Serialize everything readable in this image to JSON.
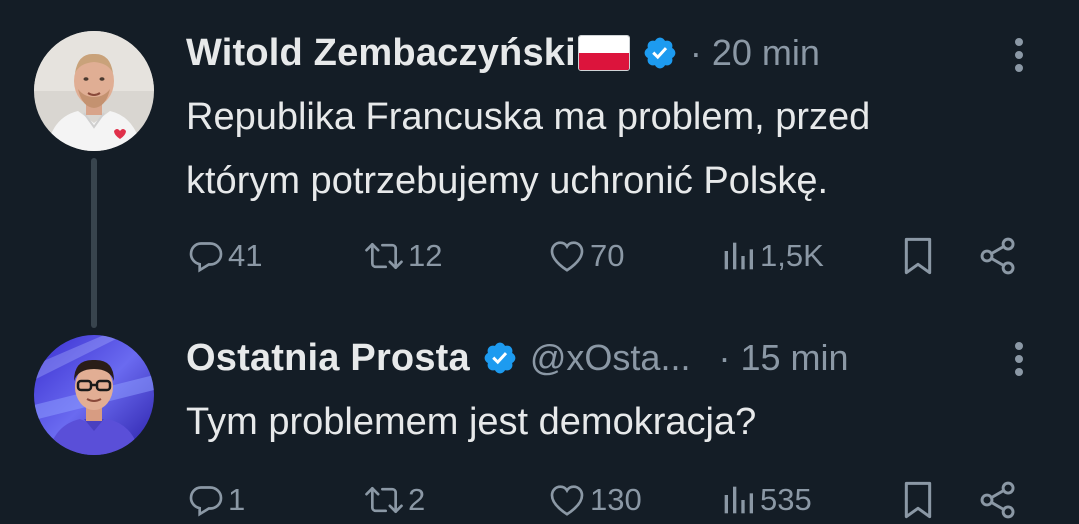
{
  "tweets": [
    {
      "author_name": "Witold Zembaczyński",
      "flag": "poland-flag-emoji",
      "verified": true,
      "time": "· 20 min",
      "text_lines": [
        "Republika Francuska ma problem, przed",
        "którym potrzebujemy uchronić Polskę."
      ],
      "stats": {
        "replies": "41",
        "reposts": "12",
        "likes": "70",
        "views": "1,5K"
      }
    },
    {
      "author_name": "Ostatnia Prosta",
      "verified": true,
      "handle": "@xOsta...",
      "time": "· 15 min",
      "text_lines": [
        "Tym problemem jest demokracja?"
      ],
      "stats": {
        "replies": "1",
        "reposts": "2",
        "likes": "130",
        "views": "535"
      }
    }
  ],
  "colors": {
    "background": "#141d26",
    "text_primary": "#e7e9ea",
    "text_secondary": "#8b98a5",
    "verified_blue": "#1d9bf0",
    "thread_line": "#38444d"
  }
}
